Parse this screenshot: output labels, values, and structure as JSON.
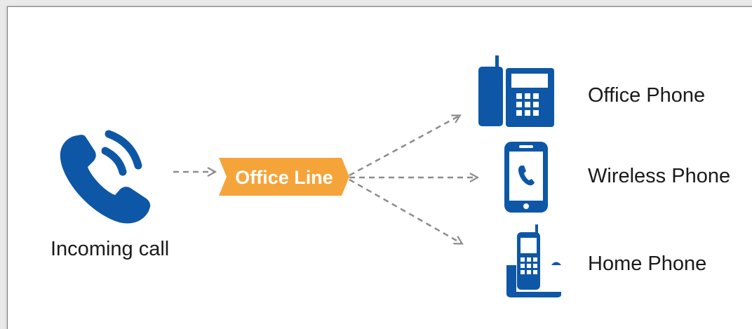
{
  "diagram": {
    "source": {
      "label": "Incoming call",
      "icon": "phone-ringing-icon"
    },
    "hub": {
      "label": "Office Line"
    },
    "destinations": [
      {
        "label": "Office Phone",
        "icon": "desk-phone-icon"
      },
      {
        "label": "Wireless Phone",
        "icon": "mobile-phone-icon"
      },
      {
        "label": "Home Phone",
        "icon": "cordless-phone-icon"
      }
    ]
  },
  "colors": {
    "icon_blue": "#0e57a6",
    "hub_orange": "#f5a43a",
    "arrow_gray": "#8c8c8c",
    "text": "#1a1a1a",
    "hub_text": "#ffffff"
  }
}
